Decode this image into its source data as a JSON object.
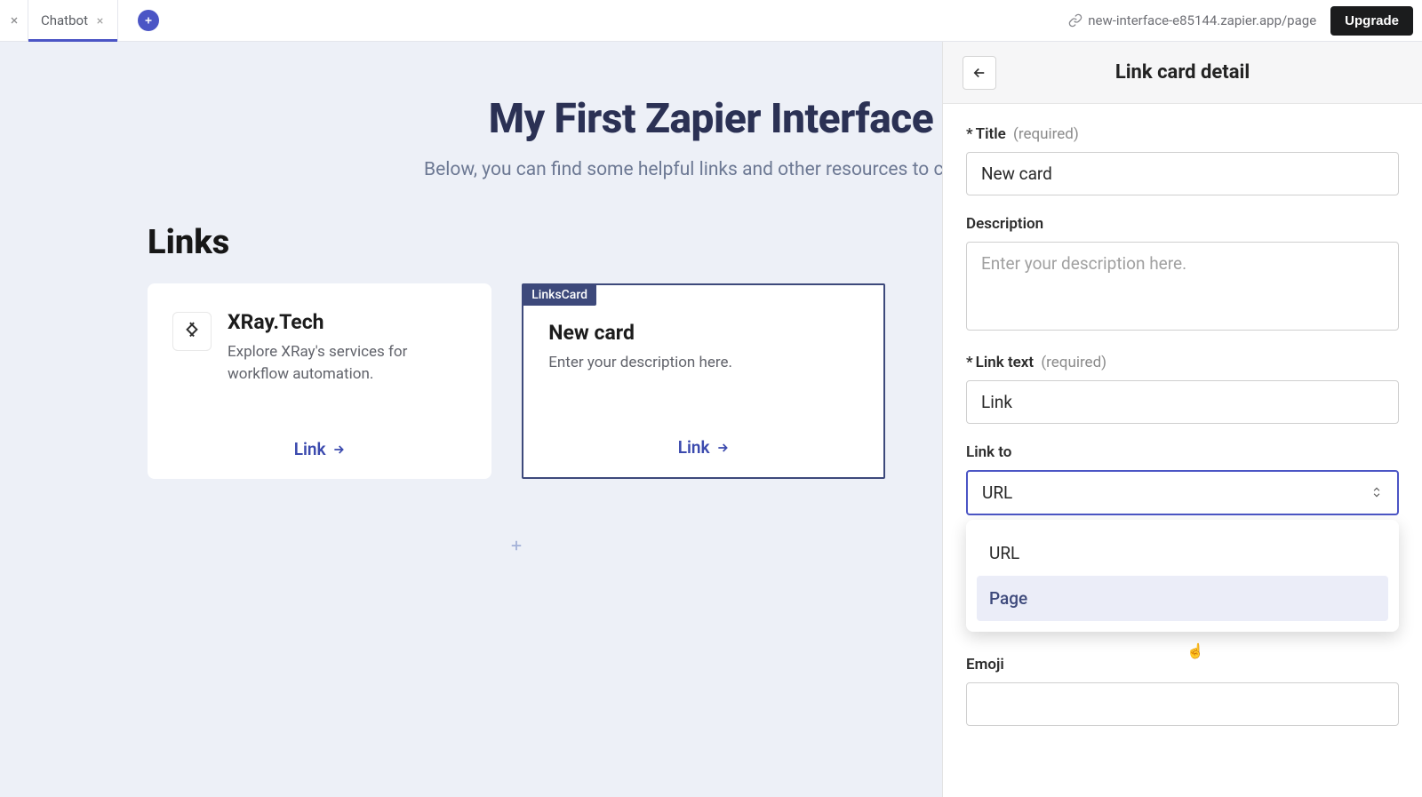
{
  "topbar": {
    "tab_label": "Chatbot",
    "url": "new-interface-e85144.zapier.app/page",
    "upgrade_label": "Upgrade"
  },
  "page": {
    "title": "My First Zapier Interface",
    "subtitle": "Below, you can find some helpful links and other resources to check o",
    "links_heading": "Links"
  },
  "cards": [
    {
      "title": "XRay.Tech",
      "desc": "Explore XRay's services for workflow automation.",
      "link_label": "Link"
    },
    {
      "badge": "LinksCard",
      "title": "New card",
      "desc": "Enter your description here.",
      "link_label": "Link"
    }
  ],
  "panel": {
    "title": "Link card detail",
    "title_field_label": "Title",
    "required_hint": "(required)",
    "title_value": "New card",
    "description_label": "Description",
    "description_placeholder": "Enter your description here.",
    "link_text_label": "Link text",
    "link_text_value": "Link",
    "link_to_label": "Link to",
    "link_to_value": "URL",
    "dropdown_options": [
      "URL",
      "Page"
    ],
    "emoji_label": "Emoji"
  }
}
